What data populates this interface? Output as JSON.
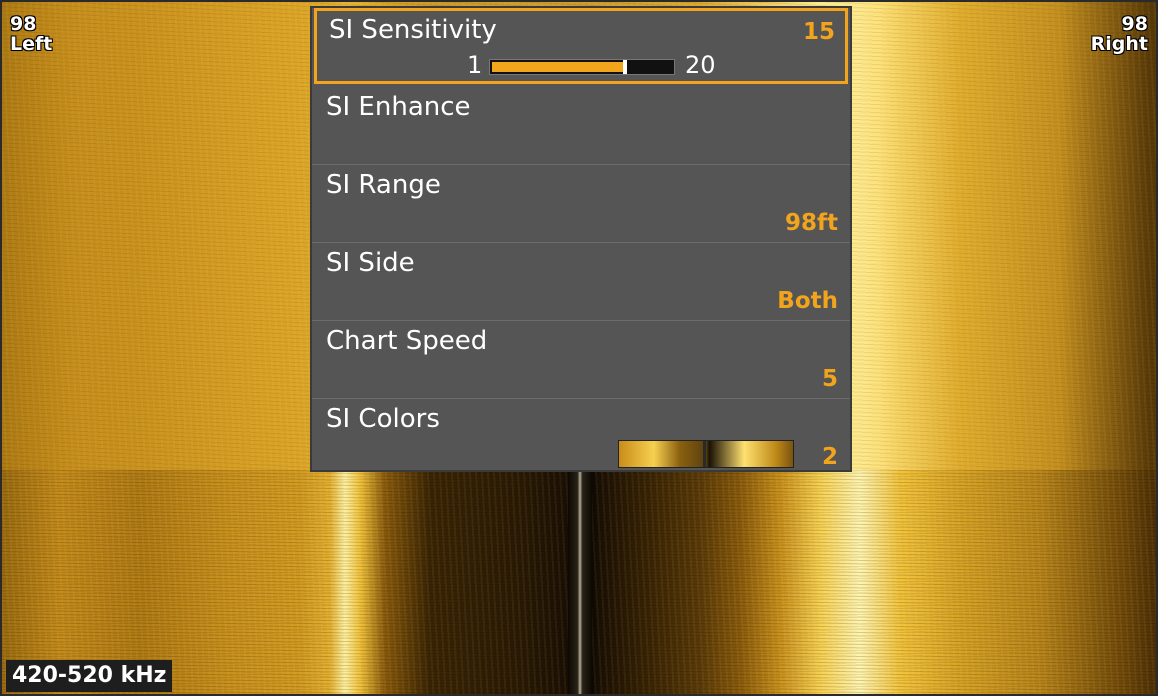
{
  "corner_left": {
    "range": "98",
    "side": "Left"
  },
  "corner_right": {
    "range": "98",
    "side": "Right"
  },
  "frequency": "420-520 kHz",
  "menu": {
    "sensitivity": {
      "label": "SI Sensitivity",
      "value": "15",
      "min": "1",
      "max": "20",
      "level": 15
    },
    "enhance": {
      "label": "SI Enhance"
    },
    "range": {
      "label": "SI Range",
      "value": "98ft"
    },
    "side": {
      "label": "SI Side",
      "value": "Both"
    },
    "chart_speed": {
      "label": "Chart Speed",
      "value": "5"
    },
    "colors": {
      "label": "SI Colors",
      "value": "2"
    }
  },
  "colors": {
    "accent": "#f2a51c",
    "menu_bg": "#555555",
    "sonar": "#e8b232"
  }
}
